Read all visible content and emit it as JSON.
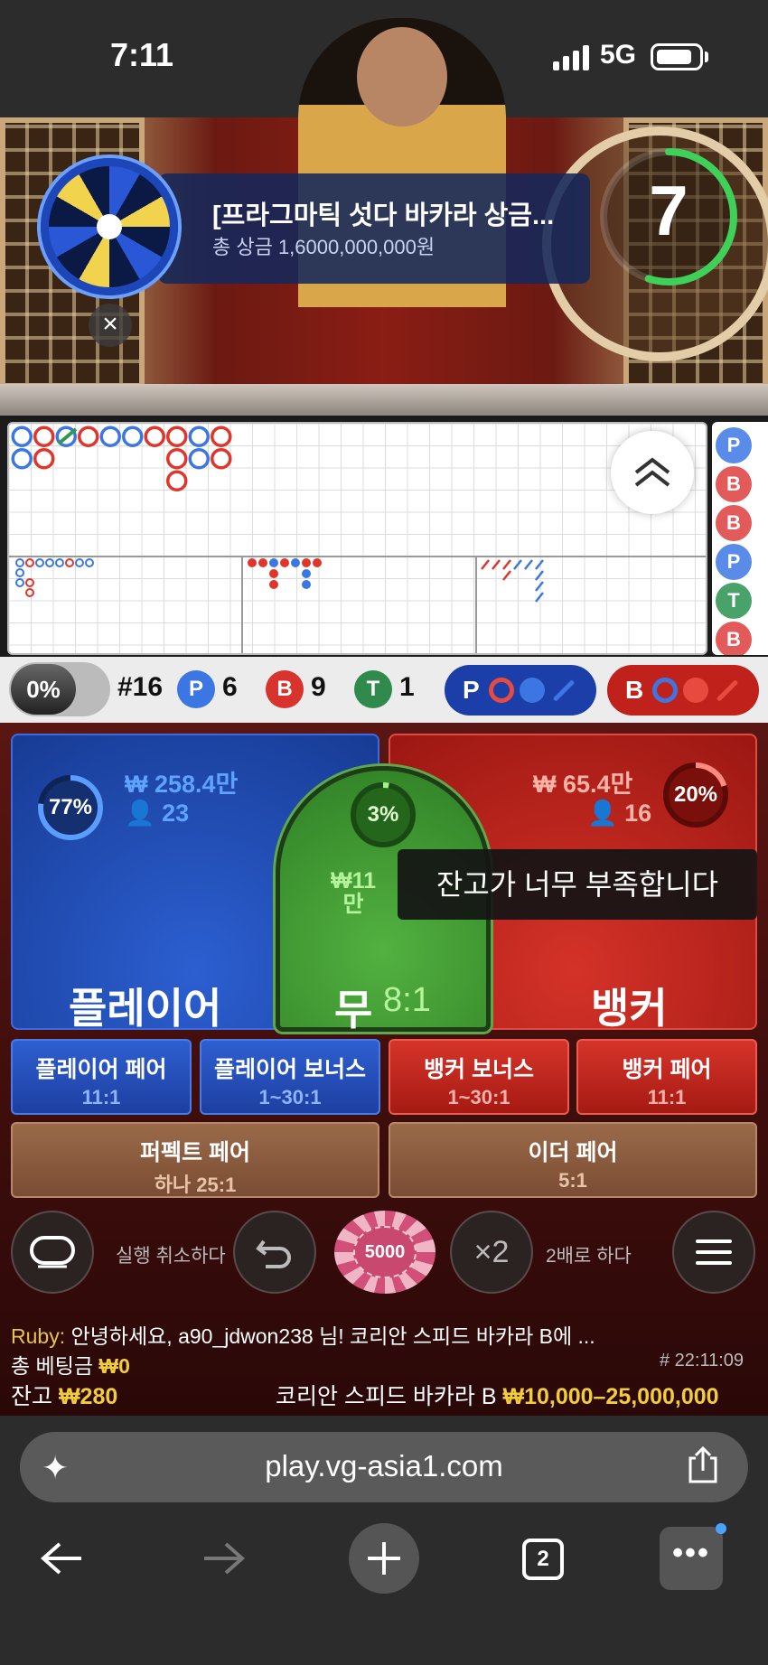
{
  "status_bar": {
    "time": "7:11",
    "network": "5G"
  },
  "video": {
    "promo_title": "[프라그마틱 섯다 바카라 상금...",
    "promo_subtitle": "총 상금 1,6000,000,000원",
    "countdown": "7",
    "countdown_fraction": 0.55,
    "close_label": "×"
  },
  "roadmap": {
    "columns": [
      [
        "P",
        "P"
      ],
      [
        "B",
        "B"
      ],
      [
        "P"
      ],
      [
        "B"
      ],
      [
        "P"
      ],
      [
        "P"
      ],
      [
        "B"
      ],
      [
        "B",
        "B",
        "B"
      ],
      [
        "P",
        "P"
      ],
      [
        "B",
        "B"
      ]
    ],
    "side_results": [
      "P",
      "B",
      "B",
      "P",
      "T",
      "B"
    ]
  },
  "stats": {
    "banker_pct": "0%",
    "round": "#16",
    "player_label": "P",
    "player_count": "6",
    "banker_label": "B",
    "banker_count": "9",
    "tie_label": "T",
    "tie_count": "1",
    "predict_player_label": "P",
    "predict_banker_label": "B"
  },
  "bets": {
    "player": {
      "pct": "77%",
      "pct_value": 77,
      "amount": "₩ 258.4만",
      "players": "23",
      "label": "플레이어"
    },
    "banker": {
      "pct": "20%",
      "pct_value": 20,
      "amount": "₩ 65.4만",
      "players": "16",
      "label": "뱅커"
    },
    "tie": {
      "pct": "3%",
      "pct_value": 3,
      "amount": "₩11\n만",
      "label": "무",
      "odds": "8:1"
    },
    "toast": "잔고가 너무 부족합니다",
    "side": [
      {
        "label": "플레이어 페어",
        "odds": "11:1"
      },
      {
        "label": "플레이어 보너스",
        "odds": "1~30:1"
      },
      {
        "label": "뱅커 보너스",
        "odds": "1~30:1"
      },
      {
        "label": "뱅커 페어",
        "odds": "11:1"
      }
    ],
    "perfect_pair": {
      "label": "퍼펙트 페어",
      "odds": "하나 25:1"
    },
    "either_pair": {
      "label": "이더 페어",
      "odds": "5:1"
    }
  },
  "controls": {
    "undo_label": "실행 취소하다",
    "chip_value": "5000",
    "double_symbol": "×2",
    "double_label": "2배로 하다"
  },
  "info": {
    "chat_user": "Ruby:",
    "chat_text": " 안녕하세요, a90_jdwon238 님! 코리안 스피드 바카라 B에 ...",
    "total_bet_label": "총 베팅금 ",
    "total_bet": "₩0",
    "round_id": "# 22:11:09",
    "balance_label": "잔고 ",
    "balance": "₩280",
    "table_name": "코리안 스피드 바카라 B ",
    "limits": "₩10,000–25,000,000"
  },
  "browser": {
    "url": "play.vg-asia1.com",
    "tab_count": "2",
    "more": "•••"
  },
  "colors": {
    "player": "#2c5fd1",
    "banker": "#d43228",
    "tie": "#52b140",
    "gold": "#f2cd3a"
  }
}
